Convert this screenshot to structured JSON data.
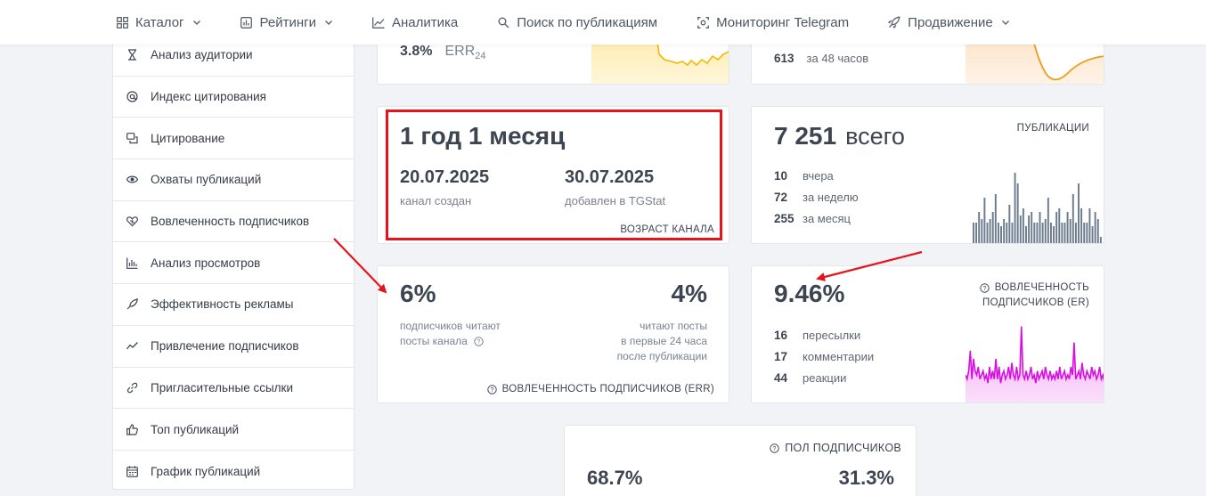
{
  "nav": {
    "catalog": "Каталог",
    "ratings": "Рейтинги",
    "analytics": "Аналитика",
    "search": "Поиск по публикациям",
    "monitoring": "Мониторинг Telegram",
    "promotion": "Продвижение"
  },
  "sidebar": {
    "items": [
      {
        "label": "Анализ аудитории",
        "icon": "hourglass-icon"
      },
      {
        "label": "Индекс цитирования",
        "icon": "at-icon"
      },
      {
        "label": "Цитирование",
        "icon": "quote-icon"
      },
      {
        "label": "Охваты публикаций",
        "icon": "eye-icon"
      },
      {
        "label": "Вовлеченность подписчиков",
        "icon": "heart-icon"
      },
      {
        "label": "Анализ просмотров",
        "icon": "bar-chart-icon"
      },
      {
        "label": "Эффективность рекламы",
        "icon": "rocket-icon"
      },
      {
        "label": "Привлечение подписчиков",
        "icon": "trend-icon"
      },
      {
        "label": "Пригласительные ссылки",
        "icon": "link-icon"
      },
      {
        "label": "Топ публикаций",
        "icon": "thumbs-up-icon"
      },
      {
        "label": "График публикаций",
        "icon": "calendar-icon"
      }
    ]
  },
  "top_left_card": {
    "value": "3.8%",
    "label": "ERR",
    "sub": "24"
  },
  "top_right_card": {
    "value": "613",
    "label": "за 48 часов"
  },
  "age_card": {
    "title": "1 год 1 месяц",
    "created_date": "20.07.2025",
    "created_label": "канал создан",
    "added_date": "30.07.2025",
    "added_label": "добавлен в TGStat",
    "caption": "ВОЗРАСТ КАНАЛА"
  },
  "posts_card": {
    "total_value": "7 251",
    "total_label": "всего",
    "caption": "ПУБЛИКАЦИИ",
    "stats": [
      {
        "n": "10",
        "label": "вчера"
      },
      {
        "n": "72",
        "label": "за неделю"
      },
      {
        "n": "255",
        "label": "за месяц"
      }
    ],
    "bars": [
      0.3,
      0.3,
      0.45,
      0.35,
      0.65,
      0.3,
      0.35,
      0.45,
      0.7,
      0.3,
      0.25,
      0.35,
      0.3,
      0.55,
      0.3,
      1.0,
      0.85,
      0.4,
      0.5,
      0.25,
      0.4,
      0.45,
      0.3,
      0.3,
      0.45,
      0.3,
      0.35,
      0.65,
      0.3,
      0.25,
      0.45,
      0.5,
      0.3,
      0.3,
      0.45,
      0.35,
      0.7,
      0.3,
      0.85,
      0.5,
      0.3,
      0.3,
      0.5,
      0.25,
      0.45,
      0.35,
      0.1
    ]
  },
  "err_card": {
    "left_value": "6%",
    "left_label_1": "подписчиков читают",
    "left_label_2": "посты канала",
    "right_value": "4%",
    "right_label_1": "читают посты",
    "right_label_2": "в первые 24 часа",
    "right_label_3": "после публикации",
    "caption": "ВОВЛЕЧЕННОСТЬ ПОДПИСЧИКОВ (ERR)"
  },
  "er_card": {
    "value": "9.46%",
    "caption_1": "ВОВЛЕЧЕННОСТЬ",
    "caption_2": "ПОДПИСЧИКОВ (ER)",
    "stats": [
      {
        "n": "16",
        "label": "пересылки"
      },
      {
        "n": "17",
        "label": "комментарии"
      },
      {
        "n": "44",
        "label": "реакции"
      }
    ],
    "line": [
      0.35,
      0.3,
      0.4,
      0.65,
      0.3,
      0.55,
      0.4,
      0.35,
      0.45,
      0.3,
      0.35,
      0.4,
      0.3,
      0.35,
      0.25,
      0.45,
      0.3,
      0.4,
      0.3,
      0.55,
      0.3,
      0.45,
      0.25,
      0.35,
      0.4,
      0.3,
      0.35,
      0.45,
      0.3,
      0.5,
      0.35,
      0.3,
      0.45,
      0.3,
      0.35,
      0.95,
      0.35,
      0.3,
      0.4,
      0.3,
      0.35,
      0.45,
      0.3,
      0.35,
      0.25,
      0.4,
      0.3,
      0.35,
      0.4,
      0.3,
      0.45,
      0.35,
      0.3,
      0.4,
      0.3,
      0.35,
      0.3,
      0.4,
      0.3,
      0.45,
      0.3,
      0.35,
      0.4,
      0.3,
      0.35,
      0.3,
      0.45,
      0.35,
      0.75,
      0.3,
      0.35,
      0.4,
      0.3,
      0.5,
      0.35,
      0.3,
      0.4,
      0.35,
      0.3,
      0.45,
      0.35,
      0.4,
      0.3,
      0.35,
      0.45,
      0.3,
      0.35,
      0.25
    ]
  },
  "gender_card": {
    "caption": "ПОЛ ПОДПИСЧИКОВ",
    "male_value": "68.7%",
    "female_value": "31.3%"
  },
  "colors": {
    "accent_red": "#e5141b",
    "bars": "#6b7a8c",
    "er_line": "#d610e0",
    "er_fill": "#f7c3f7",
    "err_line": "#f5b800",
    "subs_line": "#f19a1a"
  }
}
